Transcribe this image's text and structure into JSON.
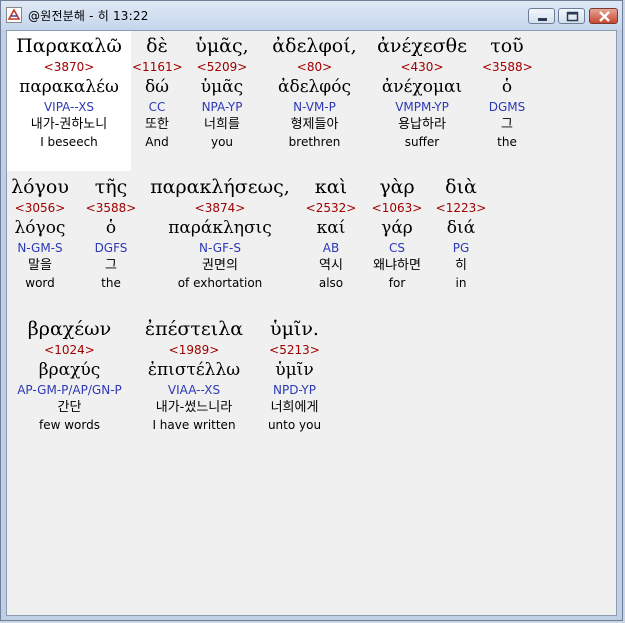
{
  "window": {
    "title": "@원전분해 - 히 13:22",
    "icon": "app-logo-icon"
  },
  "words": [
    {
      "greek": "Παρακαλῶ",
      "strong": "<3870>",
      "lemma": "παρακαλέω",
      "parse": "VIPA--XS",
      "korean": "내가-권하노니",
      "english": "I beseech"
    },
    {
      "greek": "δὲ",
      "strong": "<1161>",
      "lemma": "δώ",
      "parse": "CC",
      "korean": "또한",
      "english": "And"
    },
    {
      "greek": "ὑμᾶς,",
      "strong": "<5209>",
      "lemma": "ὑμᾶς",
      "parse": "NPA-YP",
      "korean": "너희를",
      "english": "you"
    },
    {
      "greek": "ἀδελφοί,",
      "strong": "<80>",
      "lemma": "ἀδελφός",
      "parse": "N-VM-P",
      "korean": "형제들아",
      "english": "brethren"
    },
    {
      "greek": "ἀνέχεσθε",
      "strong": "<430>",
      "lemma": "ἀνέχομαι",
      "parse": "VMPM-YP",
      "korean": "용납하라",
      "english": "suffer"
    },
    {
      "greek": "τοῦ",
      "strong": "<3588>",
      "lemma": "ὁ",
      "parse": "DGMS",
      "korean": "그",
      "english": "the"
    },
    {
      "greek": "λόγου",
      "strong": "<3056>",
      "lemma": "λόγος",
      "parse": "N-GM-S",
      "korean": "말을",
      "english": "word"
    },
    {
      "greek": "τῆς",
      "strong": "<3588>",
      "lemma": "ὁ",
      "parse": "DGFS",
      "korean": "그",
      "english": "the"
    },
    {
      "greek": "παρακλήσεως,",
      "strong": "<3874>",
      "lemma": "παράκλησις",
      "parse": "N-GF-S",
      "korean": "권면의",
      "english": "of exhortation"
    },
    {
      "greek": "καὶ",
      "strong": "<2532>",
      "lemma": "καί",
      "parse": "AB",
      "korean": "역시",
      "english": "also"
    },
    {
      "greek": "γὰρ",
      "strong": "<1063>",
      "lemma": "γάρ",
      "parse": "CS",
      "korean": "왜냐하면",
      "english": "for"
    },
    {
      "greek": "διὰ",
      "strong": "<1223>",
      "lemma": "διά",
      "parse": "PG",
      "korean": "히",
      "english": "in"
    },
    {
      "greek": "βραχέων",
      "strong": "<1024>",
      "lemma": "βραχύς",
      "parse": "AP-GM-P/AP/GN-P",
      "korean": "간단",
      "english": "few words"
    },
    {
      "greek": "ἐπέστειλα",
      "strong": "<1989>",
      "lemma": "ἐπιστέλλω",
      "parse": "VIAA--XS",
      "korean": "내가-썼느니라",
      "english": "I have written"
    },
    {
      "greek": "ὑμῖν.",
      "strong": "<5213>",
      "lemma": "ὑμῖν",
      "parse": "NPD-YP",
      "korean": "너희에게",
      "english": "unto you"
    }
  ]
}
